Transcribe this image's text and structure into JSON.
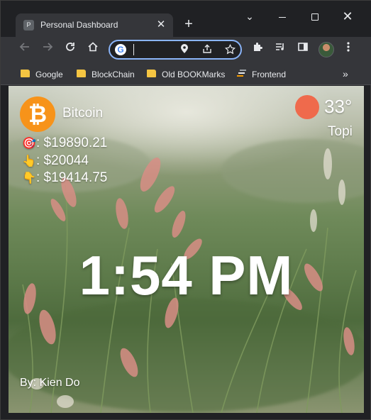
{
  "browser": {
    "tab": {
      "favicon_letter": "P",
      "title": "Personal Dashboard",
      "close_glyph": "✕"
    },
    "new_tab_glyph": "+",
    "window_controls": {
      "tabsearch": "⌄",
      "close": "✕"
    },
    "omnibox": {
      "value": "",
      "google_glyph": "G"
    },
    "bookmarks": [
      {
        "label": "Google"
      },
      {
        "label": "BlockChain"
      },
      {
        "label": "Old BOOKMarks"
      },
      {
        "label": "Frontend"
      }
    ],
    "more_bookmarks_glyph": "»"
  },
  "dashboard": {
    "crypto": {
      "symbol_glyph": "₿",
      "name": "Bitcoin",
      "current": {
        "icon": "🎯",
        "text": ": $19890.21"
      },
      "high": {
        "icon": "👆",
        "text": ": $20044"
      },
      "low": {
        "icon": "👇",
        "text": ": $19414.75"
      }
    },
    "weather": {
      "temperature": "33°",
      "city": "Topi",
      "icon": "sun-icon"
    },
    "time": "1:54 PM",
    "author": "By: Kien Do"
  },
  "colors": {
    "chrome_bg": "#202124",
    "toolbar_bg": "#35363a",
    "omnibox_border": "#8ab4f8",
    "bitcoin_orange": "#f7931a",
    "sun_red": "#ef6a4c",
    "folder_yellow": "#f5c542"
  }
}
